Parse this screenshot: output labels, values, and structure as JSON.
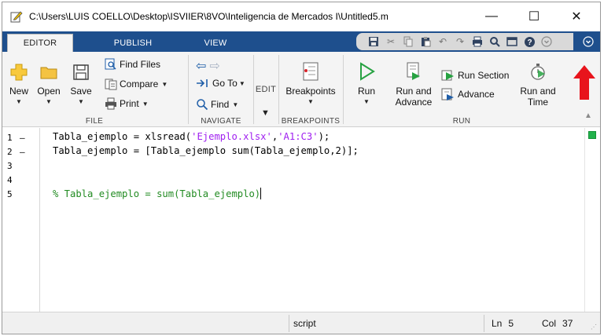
{
  "window": {
    "title": "C:\\Users\\LUIS COELLO\\Desktop\\ISVIIER\\8VO\\Inteligencia de Mercados I\\Untitled5.m",
    "controls": {
      "minimize": "—",
      "maximize": "☐",
      "close": "✕"
    }
  },
  "tabs": [
    {
      "label": "EDITOR",
      "active": true
    },
    {
      "label": "PUBLISH",
      "active": false
    },
    {
      "label": "VIEW",
      "active": false
    }
  ],
  "toolstrip": {
    "file": {
      "label": "FILE",
      "new": "New",
      "open": "Open",
      "save": "Save",
      "find_files": "Find Files",
      "compare": "Compare",
      "print": "Print"
    },
    "navigate": {
      "label": "NAVIGATE",
      "go_to": "Go To",
      "find": "Find"
    },
    "edit": {
      "label": "EDIT"
    },
    "breakpoints": {
      "label": "BREAKPOINTS",
      "breakpoints": "Breakpoints"
    },
    "run": {
      "label": "RUN",
      "run": "Run",
      "run_and_advance_1": "Run and",
      "run_and_advance_2": "Advance",
      "run_section": "Run Section",
      "advance": "Advance",
      "run_and_time_1": "Run and",
      "run_and_time_2": "Time"
    }
  },
  "editor": {
    "lines": [
      {
        "number": "1",
        "mark": "–"
      },
      {
        "number": "2",
        "mark": "–"
      },
      {
        "number": "3",
        "mark": ""
      },
      {
        "number": "4",
        "mark": ""
      },
      {
        "number": "5",
        "mark": ""
      }
    ],
    "code": {
      "line1_a": "Tabla_ejemplo = xlsread(",
      "line1_s1": "'Ejemplo.xlsx'",
      "line1_b": ",",
      "line1_s2": "'A1:C3'",
      "line1_c": ");",
      "line2": "Tabla_ejemplo = [Tabla_ejemplo sum(Tabla_ejemplo,2)];",
      "line5_comment": "% Tabla_ejemplo = sum(Tabla_ejemplo)"
    }
  },
  "statusbar": {
    "mode": "script",
    "ln_label": "Ln",
    "ln_value": "5",
    "col_label": "Col",
    "col_value": "37"
  },
  "colors": {
    "tabstrip": "#1e4f8d",
    "string": "#a020f0",
    "comment": "#228b22",
    "annotation_arrow": "#e8141c",
    "code_ok_indicator": "#21b14b"
  }
}
